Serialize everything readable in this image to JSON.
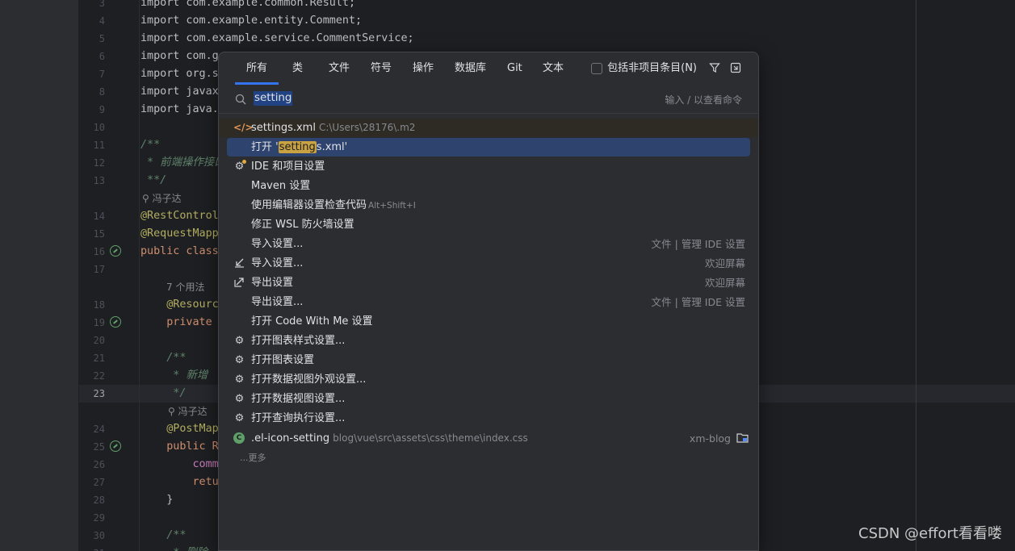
{
  "editor": {
    "current_line": "23",
    "lines": [
      {
        "n": "3",
        "text": "import com.example.common.Result;"
      },
      {
        "n": "4",
        "text": "import com.example.entity.Comment;"
      },
      {
        "n": "5",
        "text": "import com.example.service.CommentService;"
      },
      {
        "n": "6",
        "text": "import com.g"
      },
      {
        "n": "7",
        "text": "import org.s"
      },
      {
        "n": "8",
        "text": "import javax"
      },
      {
        "n": "9",
        "text": "import java."
      },
      {
        "n": "10",
        "text": ""
      },
      {
        "n": "11",
        "text": "/**"
      },
      {
        "n": "12",
        "text": " * 前端操作接口"
      },
      {
        "n": "13",
        "text": " **/"
      },
      {
        "n": "14",
        "text": "@RestControl"
      },
      {
        "n": "15",
        "text": "@RequestMapp"
      },
      {
        "n": "16",
        "text": "public class"
      },
      {
        "n": "17",
        "text": ""
      },
      {
        "n": "18",
        "text": "    @Resourc"
      },
      {
        "n": "19",
        "text": "    private "
      },
      {
        "n": "20",
        "text": ""
      },
      {
        "n": "21",
        "text": "    /**"
      },
      {
        "n": "22",
        "text": "     * 新增"
      },
      {
        "n": "23",
        "text": "     */"
      },
      {
        "n": "24",
        "text": "    @PostMap"
      },
      {
        "n": "25",
        "text": "    public R"
      },
      {
        "n": "26",
        "text": "        comm"
      },
      {
        "n": "27",
        "text": "        retu"
      },
      {
        "n": "28",
        "text": "    }"
      },
      {
        "n": "29",
        "text": ""
      },
      {
        "n": "30",
        "text": "    /**"
      },
      {
        "n": "31",
        "text": "     * 删除"
      }
    ],
    "inlay_author_1": "冯子达",
    "inlay_usages": "7 个用法",
    "inlay_author_2": "冯子达"
  },
  "popup": {
    "tabs": [
      "所有",
      "类",
      "文件",
      "符号",
      "操作",
      "数据库",
      "Git",
      "文本"
    ],
    "active_tab": "所有",
    "include_non_project_label": "包括非项目条目(N)",
    "search": {
      "value": "setting",
      "hint": "输入 / 以查看命令"
    },
    "results": [
      {
        "icon": "xml-file-icon",
        "label": "settings.xml",
        "sub": "C:\\Users\\28176\\.m2",
        "right": ""
      },
      {
        "icon": "",
        "label_pre": "打开 '",
        "label_hl": "setting",
        "label_post": "s.xml'",
        "right": ""
      },
      {
        "icon": "gear-badge-icon",
        "label": "IDE 和项目设置",
        "right": ""
      },
      {
        "icon": "",
        "label": "Maven 设置",
        "right": ""
      },
      {
        "icon": "",
        "label": "使用编辑器设置检查代码",
        "shortcut": "Alt+Shift+I",
        "right": ""
      },
      {
        "icon": "",
        "label": "修正 WSL 防火墙设置",
        "right": ""
      },
      {
        "icon": "",
        "label": "导入设置...",
        "right": "文件 | 管理 IDE 设置"
      },
      {
        "icon": "import-icon",
        "label": "导入设置...",
        "right": "欢迎屏幕"
      },
      {
        "icon": "export-icon",
        "label": "导出设置",
        "right": "欢迎屏幕"
      },
      {
        "icon": "",
        "label": "导出设置...",
        "right": "文件 | 管理 IDE 设置"
      },
      {
        "icon": "",
        "label": "打开 Code With Me 设置",
        "right": ""
      },
      {
        "icon": "gear-icon",
        "label": "打开图表样式设置...",
        "right": ""
      },
      {
        "icon": "gear-icon",
        "label": "打开图表设置",
        "right": ""
      },
      {
        "icon": "gear-icon",
        "label": "打开数据视图外观设置...",
        "right": ""
      },
      {
        "icon": "gear-icon",
        "label": "打开数据视图设置...",
        "right": ""
      },
      {
        "icon": "gear-icon",
        "label": "打开查询执行设置...",
        "right": ""
      },
      {
        "icon": "css-class-icon",
        "label": ".el-icon-setting",
        "sub": "blog\\vue\\src\\assets\\css\\theme\\index.css",
        "right": "xm-blog"
      }
    ],
    "more_label": "...更多"
  },
  "watermark": "CSDN @effort看看喽"
}
